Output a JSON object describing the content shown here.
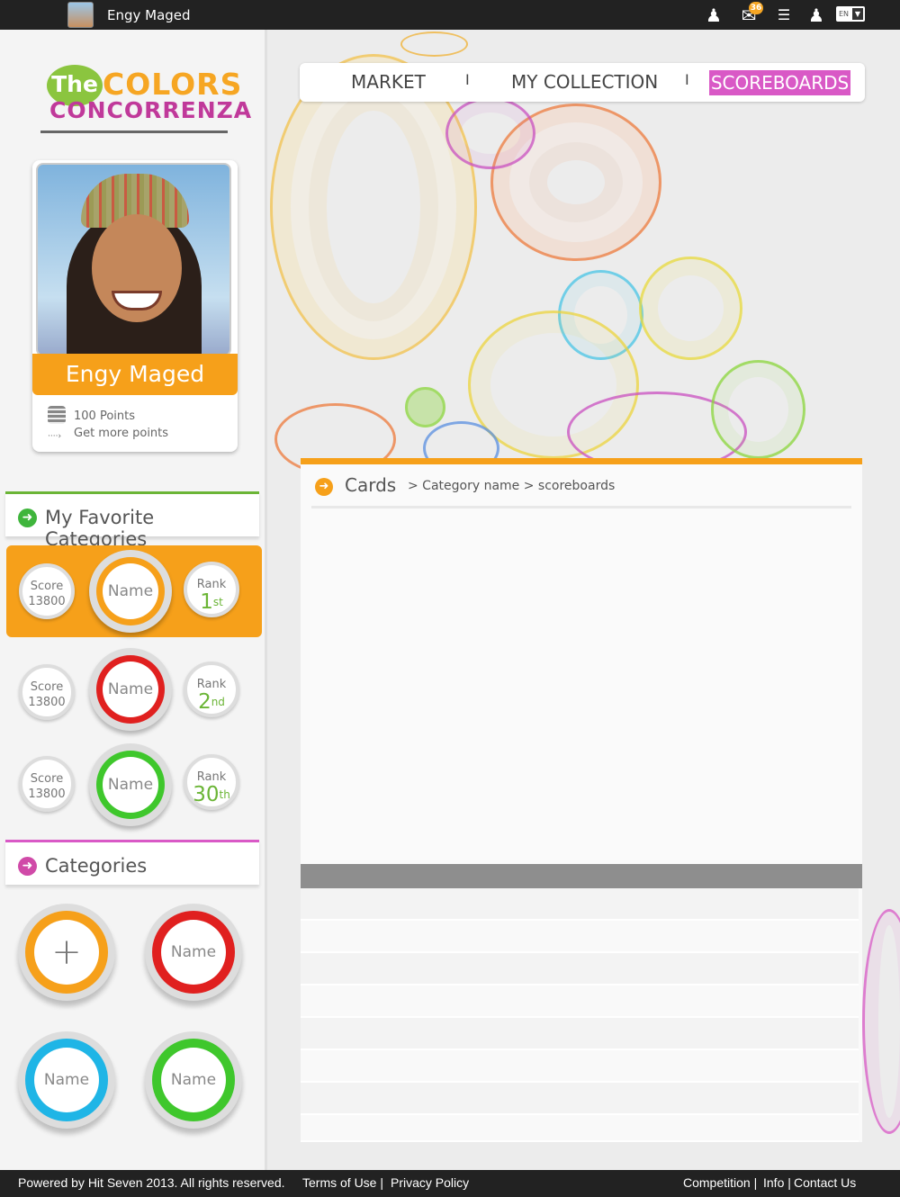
{
  "topbar": {
    "username": "Engy Maged",
    "message_count": "36",
    "language": "EN",
    "icons": [
      "add-user-icon",
      "mail-icon",
      "ranking-icon",
      "profile-icon"
    ]
  },
  "logo": {
    "part1": "The",
    "part2": "COLORS",
    "part3": "CONCORRENZA"
  },
  "profile": {
    "name": "Engy Maged",
    "points": "100 Points",
    "get_more": "Get more points"
  },
  "favorites": {
    "title": "My Favorite Categories",
    "items": [
      {
        "score_label": "Score",
        "score": "13800",
        "name": "Name",
        "rank_label": "Rank",
        "rank": "1",
        "rank_suffix": "st",
        "ring_color": "#f6a01a"
      },
      {
        "score_label": "Score",
        "score": "13800",
        "name": "Name",
        "rank_label": "Rank",
        "rank": "2",
        "rank_suffix": "nd",
        "ring_color": "#e0201f"
      },
      {
        "score_label": "Score",
        "score": "13800",
        "name": "Name",
        "rank_label": "Rank",
        "rank": "30",
        "rank_suffix": "th",
        "ring_color": "#3fc72c"
      }
    ]
  },
  "categories": {
    "title": "Categories",
    "add_symbol": "+",
    "items": [
      {
        "name": "Name",
        "ring_color": "#e0201f"
      },
      {
        "name": "Name",
        "ring_color": "#1fb5e6"
      },
      {
        "name": "Name",
        "ring_color": "#3fc72c"
      }
    ]
  },
  "nav": {
    "items": [
      "MARKET",
      "MY COLLECTION",
      "SCOREBOARDS"
    ],
    "separator": "I",
    "active": "SCOREBOARDS"
  },
  "main": {
    "title": "Cards",
    "path": "> Category name > scoreboards"
  },
  "footer": {
    "copyright": "Powered by Hit Seven 2013. All rights reserved.",
    "terms": "Terms of Use |",
    "privacy": "Privacy Policy",
    "competition": "Competition |",
    "info": "Info |",
    "contact": "Contact  Us"
  },
  "colors": {
    "orange": "#f6a01a",
    "magenta": "#d959c6",
    "green": "#6bb536"
  }
}
